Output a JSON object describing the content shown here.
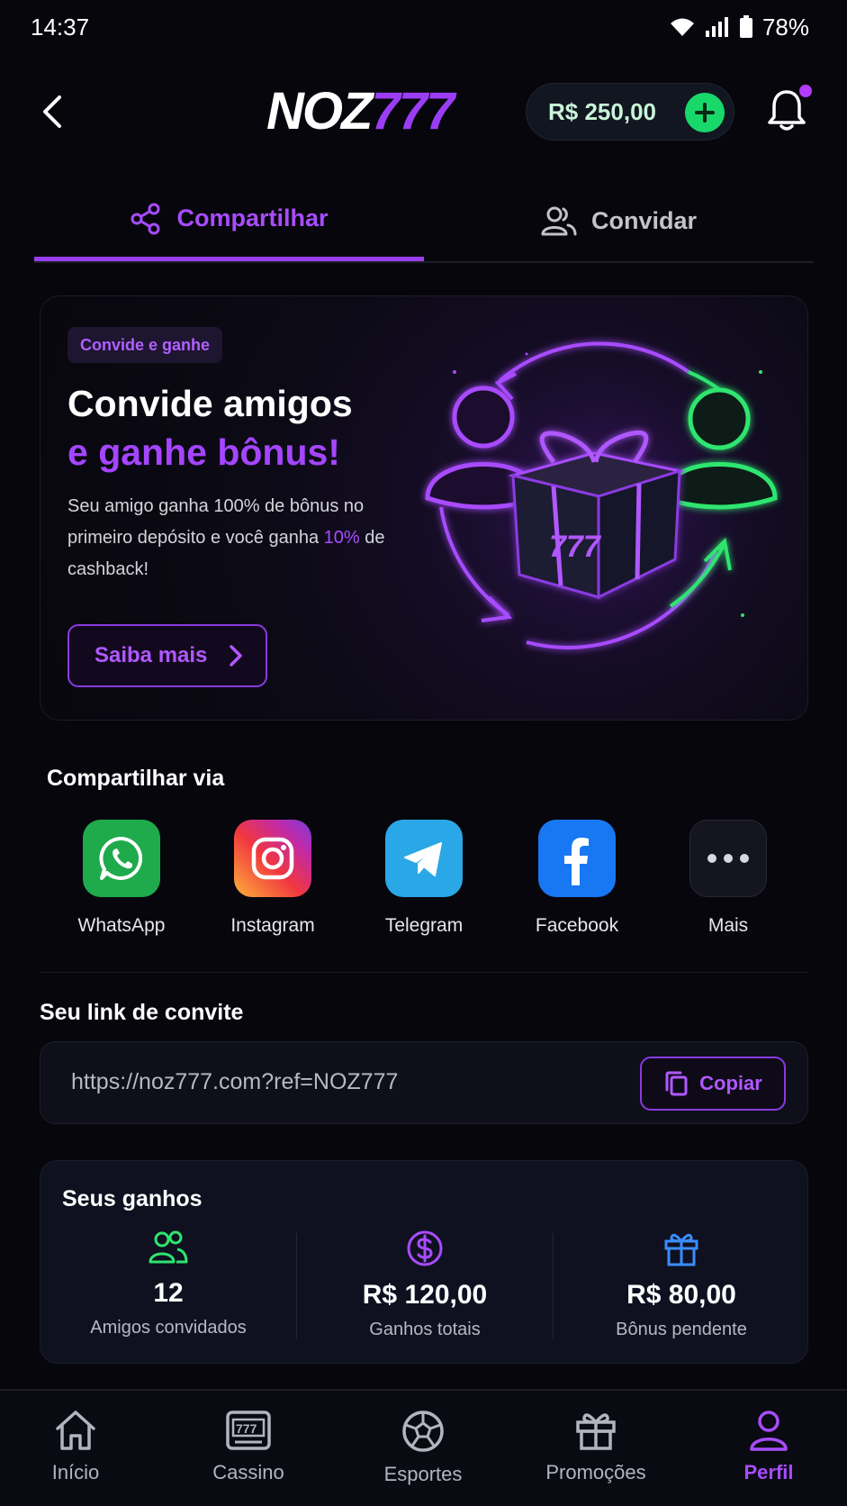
{
  "status_bar": {
    "time": "14:37",
    "battery": "78%"
  },
  "header": {
    "logo_part1": "NOZ",
    "logo_part2": "777",
    "balance": "R$ 250,00"
  },
  "tabs": [
    {
      "label": "Compartilhar",
      "active": true
    },
    {
      "label": "Convidar",
      "active": false
    }
  ],
  "promo": {
    "badge": "Convide e ganhe",
    "title_line1": "Convide amigos",
    "title_line2": "e ganhe bônus!",
    "desc_part1": "Seu amigo ganha 100% de bônus no primeiro depósito e você ganha ",
    "desc_highlight": "10%",
    "desc_part2": " de cashback!",
    "cta": "Saiba mais",
    "illustration_digits": "777"
  },
  "share": {
    "title": "Compartilhar via",
    "items": [
      {
        "label": "WhatsApp",
        "icon": "whatsapp-icon",
        "color": "#1faa4b"
      },
      {
        "label": "Instagram",
        "icon": "instagram-icon",
        "color": "#e1306c"
      },
      {
        "label": "Telegram",
        "icon": "telegram-icon",
        "color": "#2aa7e6"
      },
      {
        "label": "Facebook",
        "icon": "facebook-icon",
        "color": "#1877f2"
      },
      {
        "label": "Mais",
        "icon": "more-icon",
        "color": "#14151e"
      }
    ]
  },
  "invite_link": {
    "title": "Seu link de convite",
    "url": "https://noz777.com?ref=NOZ777",
    "copy_label": "Copiar"
  },
  "earnings": {
    "title": "Seus ganhos",
    "stats": [
      {
        "value": "12",
        "label": "Amigos convidados",
        "icon": "users-icon",
        "color": "#2ee56f"
      },
      {
        "value": "R$ 120,00",
        "label": "Ganhos totais",
        "icon": "dollar-icon",
        "color": "#a84cff"
      },
      {
        "value": "R$ 80,00",
        "label": "Bônus pendente",
        "icon": "gift-icon",
        "color": "#3b8cff"
      }
    ]
  },
  "bottom_nav": [
    {
      "label": "Início",
      "icon": "home-icon"
    },
    {
      "label": "Cassino",
      "icon": "slot-machine-icon",
      "icon_text": "777"
    },
    {
      "label": "Esportes",
      "icon": "soccer-ball-icon"
    },
    {
      "label": "Promoções",
      "icon": "gift-icon"
    },
    {
      "label": "Perfil",
      "icon": "user-icon",
      "active": true
    }
  ],
  "colors": {
    "accent": "#a84cff",
    "success": "#18d86a",
    "background": "#07060d"
  }
}
